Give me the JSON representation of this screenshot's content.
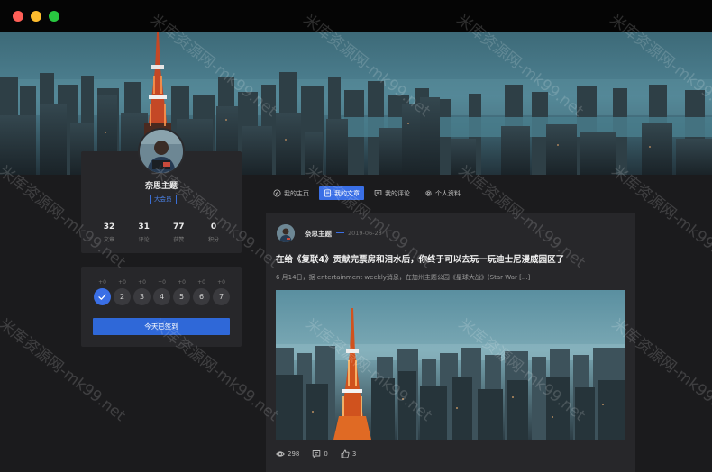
{
  "window": {
    "controls": [
      "close",
      "minimize",
      "maximize"
    ]
  },
  "profile": {
    "username": "奈思主题",
    "badge": "大会员",
    "stats": [
      {
        "value": "32",
        "label": "文章"
      },
      {
        "value": "31",
        "label": "评论"
      },
      {
        "value": "77",
        "label": "获赞"
      },
      {
        "value": "0",
        "label": "积分"
      }
    ]
  },
  "checkin": {
    "days": [
      {
        "bonus": "+0",
        "label": "",
        "done": true
      },
      {
        "bonus": "+0",
        "label": "2",
        "done": false
      },
      {
        "bonus": "+0",
        "label": "3",
        "done": false
      },
      {
        "bonus": "+0",
        "label": "4",
        "done": false
      },
      {
        "bonus": "+0",
        "label": "5",
        "done": false
      },
      {
        "bonus": "+0",
        "label": "6",
        "done": false
      },
      {
        "bonus": "+0",
        "label": "7",
        "done": false
      }
    ],
    "button_label": "今天已签到"
  },
  "tabs": [
    {
      "label": "我的主页",
      "icon": "home-icon",
      "active": false
    },
    {
      "label": "我的文章",
      "icon": "document-icon",
      "active": true
    },
    {
      "label": "我的评论",
      "icon": "comment-icon",
      "active": false
    },
    {
      "label": "个人资料",
      "icon": "gear-icon",
      "active": false
    }
  ],
  "post": {
    "author": "奈思主题",
    "date": "2019-06-28",
    "title": "在给《复联4》贡献完票房和泪水后，你终于可以去玩一玩迪士尼漫威园区了",
    "excerpt": "6 月14日，据 entertainment weekly消息，在加州主题公园《星球大战》(Star War [...]",
    "views": "298",
    "comments": "0",
    "likes": "3"
  },
  "watermark": {
    "text": "米库资源网-mk99.net"
  },
  "colors": {
    "accent": "#3a6fe6",
    "card": "#27272a",
    "background": "#1b1b1d"
  }
}
